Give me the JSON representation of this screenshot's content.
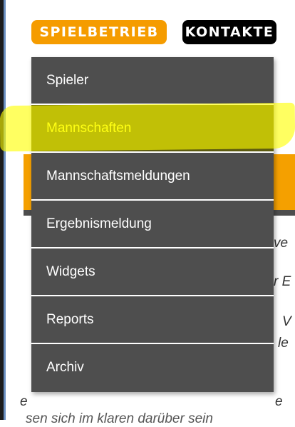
{
  "topnav": {
    "spielbetrieb_label": "SPIELBETRIEB",
    "kontakte_label": "KONTAKTE"
  },
  "menu": {
    "items": [
      {
        "label": "Spieler"
      },
      {
        "label": "Mannschaften",
        "active": true
      },
      {
        "label": "Mannschaftsmeldungen"
      },
      {
        "label": "Ergebnismeldung"
      },
      {
        "label": "Widgets"
      },
      {
        "label": "Reports"
      },
      {
        "label": "Archiv"
      }
    ]
  },
  "background_text": {
    "frag1": "ve",
    "frag2": "r E",
    "frag3": "V",
    "frag4": "le",
    "frag5": "e",
    "frag6": "e",
    "frag7": "sen sich im klaren darüber sein"
  },
  "colors": {
    "accent": "#f59c00",
    "menu_bg": "#4e4e4e",
    "active_bg": "#5d5b10",
    "active_text": "#ffff33",
    "highlight": "#ffff00"
  }
}
